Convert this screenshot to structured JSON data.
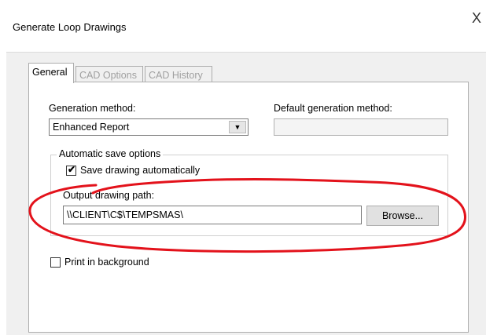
{
  "window": {
    "title": "Generate Loop Drawings",
    "close_glyph": "X"
  },
  "tabs": [
    {
      "label": "General",
      "active": true
    },
    {
      "label": "CAD Options",
      "active": false
    },
    {
      "label": "CAD History",
      "active": false
    }
  ],
  "general": {
    "generation_method_label": "Generation method:",
    "generation_method_value": "Enhanced Report",
    "default_generation_label": "Default generation method:",
    "default_generation_value": "",
    "auto_save_group_label": "Automatic save options",
    "save_auto_label": "Save drawing automatically",
    "save_auto_checked": true,
    "output_path_label": "Output drawing path:",
    "output_path_value": "\\\\CLIENT\\C$\\TEMPSMAS\\",
    "browse_label": "Browse...",
    "print_background_label": "Print in background",
    "print_background_checked": false
  },
  "colors": {
    "annotation": "#e3121b"
  }
}
